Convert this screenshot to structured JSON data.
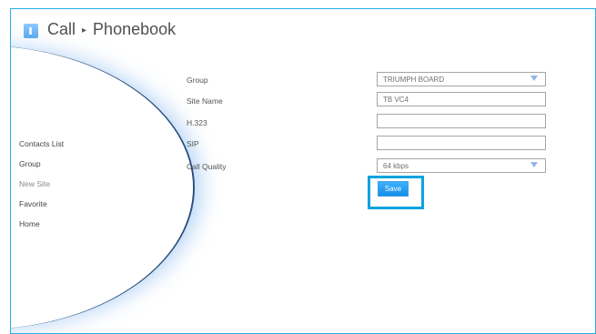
{
  "header": {
    "section": "Call",
    "separator": "▸",
    "page": "Phonebook"
  },
  "sidebar": {
    "items": [
      {
        "label": "Contacts List"
      },
      {
        "label": "Group"
      },
      {
        "label": "New Site"
      },
      {
        "label": "Favorite"
      },
      {
        "label": "Home"
      }
    ]
  },
  "form": {
    "group": {
      "label": "Group",
      "value": "TRIUMPH BOARD"
    },
    "site_name": {
      "label": "Site Name",
      "value": "TB VC4"
    },
    "h323": {
      "label": "H.323",
      "value": ""
    },
    "sip": {
      "label": "SIP",
      "value": ""
    },
    "call_quality": {
      "label": "Call Quality",
      "value": "64 kbps"
    },
    "save_label": "Save"
  },
  "colors": {
    "accent": "#27aee6",
    "highlight": "#0ea3df",
    "button": "#148de5"
  },
  "icons": {
    "back": "back-square-icon",
    "dropdown": "triangle-down-icon"
  }
}
